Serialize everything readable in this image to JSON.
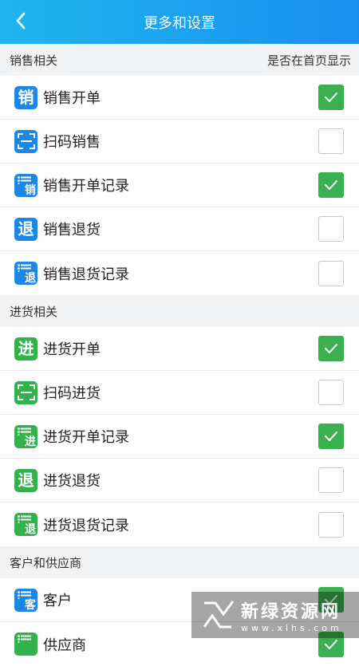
{
  "header": {
    "title": "更多和设置",
    "back_icon": "chevron-left-icon"
  },
  "sections": [
    {
      "title": "销售相关",
      "right_label": "是否在首页显示",
      "items": [
        {
          "label": "销售开单",
          "icon": "sale-order-icon",
          "glyph": "销",
          "type": "char",
          "color": "#1b87e6",
          "checked": true
        },
        {
          "label": "扫码销售",
          "icon": "scan-icon",
          "glyph": "",
          "type": "scan",
          "color": "#1b87e6",
          "checked": false
        },
        {
          "label": "销售开单记录",
          "icon": "sale-record-icon",
          "glyph": "销",
          "type": "list",
          "color": "#1b87e6",
          "checked": true
        },
        {
          "label": "销售退货",
          "icon": "sale-return-icon",
          "glyph": "退",
          "type": "char",
          "color": "#1b87e6",
          "checked": false
        },
        {
          "label": "销售退货记录",
          "icon": "sale-return-record-icon",
          "glyph": "退",
          "type": "list",
          "color": "#1b87e6",
          "checked": false
        }
      ]
    },
    {
      "title": "进货相关",
      "right_label": "",
      "items": [
        {
          "label": "进货开单",
          "icon": "purchase-order-icon",
          "glyph": "进",
          "type": "char",
          "color": "#32b24a",
          "checked": true
        },
        {
          "label": "扫码进货",
          "icon": "scan-icon",
          "glyph": "",
          "type": "scan",
          "color": "#32b24a",
          "checked": false
        },
        {
          "label": "进货开单记录",
          "icon": "purchase-record-icon",
          "glyph": "进",
          "type": "list",
          "color": "#32b24a",
          "checked": true
        },
        {
          "label": "进货退货",
          "icon": "purchase-return-icon",
          "glyph": "退",
          "type": "char",
          "color": "#32b24a",
          "checked": false
        },
        {
          "label": "进货退货记录",
          "icon": "purchase-return-record-icon",
          "glyph": "退",
          "type": "list",
          "color": "#32b24a",
          "checked": false
        }
      ]
    },
    {
      "title": "客户和供应商",
      "right_label": "",
      "items": [
        {
          "label": "客户",
          "icon": "customer-icon",
          "glyph": "客",
          "type": "list",
          "color": "#1b87e6",
          "checked": true
        },
        {
          "label": "供应商",
          "icon": "supplier-icon",
          "glyph": "",
          "type": "list",
          "color": "#32b24a",
          "checked": true
        }
      ]
    }
  ],
  "colors": {
    "header_start": "#1fb6ee",
    "header_end": "#1a8ff0",
    "check_green": "#3bb04f",
    "icon_blue": "#1b87e6",
    "icon_green": "#32b24a"
  },
  "watermark": {
    "cn": "新绿资源网",
    "en": "www.xlhs.com"
  }
}
